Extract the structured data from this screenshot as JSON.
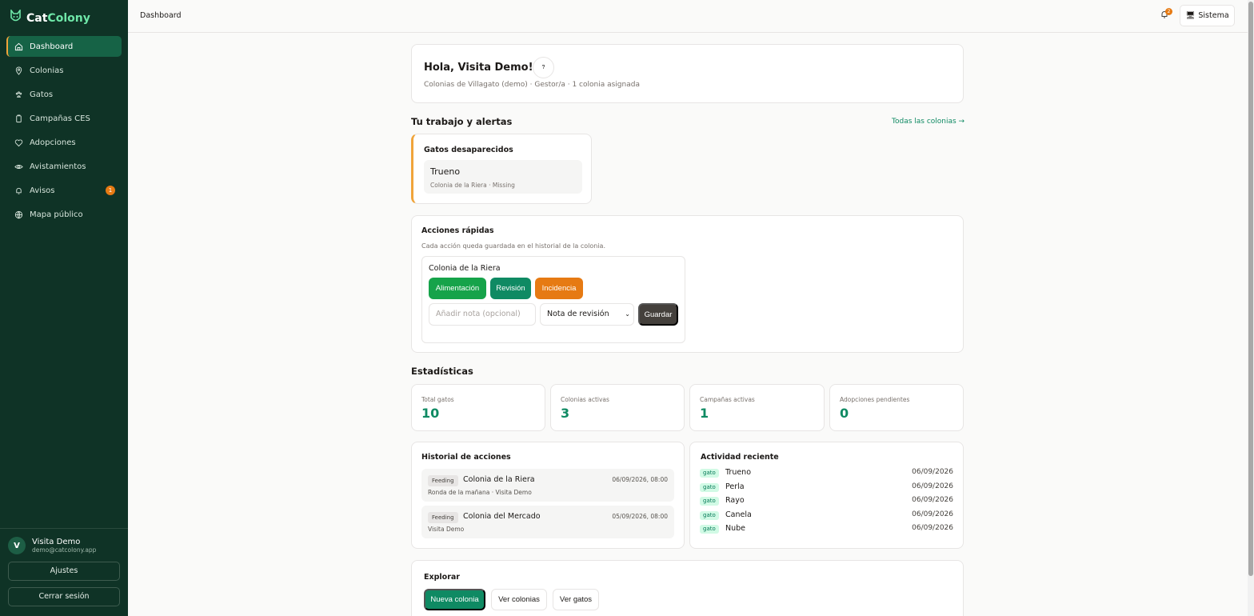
{
  "brand": {
    "name_a": "Cat",
    "name_b": "Colony"
  },
  "sidebar": {
    "items": [
      {
        "label": "Dashboard"
      },
      {
        "label": "Colonias"
      },
      {
        "label": "Gatos"
      },
      {
        "label": "Campañas CES"
      },
      {
        "label": "Adopciones"
      },
      {
        "label": "Avistamientos"
      },
      {
        "label": "Avisos",
        "badge": "1"
      },
      {
        "label": "Mapa público"
      }
    ],
    "user": {
      "initial": "V",
      "name": "Visita Demo",
      "email": "demo@catcolony.app"
    },
    "settings_label": "Ajustes",
    "logout_label": "Cerrar sesión"
  },
  "topbar": {
    "breadcrumb": "Dashboard",
    "notif_count": "2",
    "theme_label": "Sistema"
  },
  "welcome": {
    "title": "Hola, Visita Demo!",
    "help": "?",
    "subtitle": "Colonias de Villagato (demo) · Gestor/a · 1 colonia asignada"
  },
  "alerts": {
    "section_title": "Tu trabajo y alertas",
    "all_link": "Todas las colonias →",
    "card_title": "Gatos desaparecidos",
    "item_name": "Trueno",
    "item_meta": "Colonia de la Riera · Missing"
  },
  "quick_actions": {
    "title": "Acciones rápidas",
    "subtitle": "Cada acción queda guardada en el historial de la colonia.",
    "colony": "Colonia de la Riera",
    "btn_feeding": "Alimentación",
    "btn_review": "Revisión",
    "btn_incident": "Incidencia",
    "note_placeholder": "Añadir nota (opcional)",
    "note_type": "Nota de revisión",
    "save": "Guardar",
    "colors": {
      "feeding": "#16a34a",
      "review": "#0f8a63",
      "incident": "#e67a13"
    }
  },
  "stats": {
    "section_title": "Estadísticas",
    "items": [
      {
        "label": "Total gatos",
        "value": "10"
      },
      {
        "label": "Colonias activas",
        "value": "3"
      },
      {
        "label": "Campañas activas",
        "value": "1"
      },
      {
        "label": "Adopciones pendientes",
        "value": "0"
      }
    ]
  },
  "history": {
    "title": "Historial de acciones",
    "items": [
      {
        "tag": "Feeding",
        "colony": "Colonia de la Riera",
        "date": "06/09/2026, 08:00",
        "meta": "Ronda de la mañana · Visita Demo"
      },
      {
        "tag": "Feeding",
        "colony": "Colonia del Mercado",
        "date": "05/09/2026, 08:00",
        "meta": "Visita Demo"
      }
    ]
  },
  "activity": {
    "title": "Actividad reciente",
    "items": [
      {
        "tag": "gato",
        "name": "Trueno",
        "date": "06/09/2026"
      },
      {
        "tag": "gato",
        "name": "Perla",
        "date": "06/09/2026"
      },
      {
        "tag": "gato",
        "name": "Rayo",
        "date": "06/09/2026"
      },
      {
        "tag": "gato",
        "name": "Canela",
        "date": "06/09/2026"
      },
      {
        "tag": "gato",
        "name": "Nube",
        "date": "06/09/2026"
      }
    ]
  },
  "explore": {
    "title": "Explorar",
    "new_colony": "Nueva colonia",
    "view_colonies": "Ver colonias",
    "view_cats": "Ver gatos"
  }
}
